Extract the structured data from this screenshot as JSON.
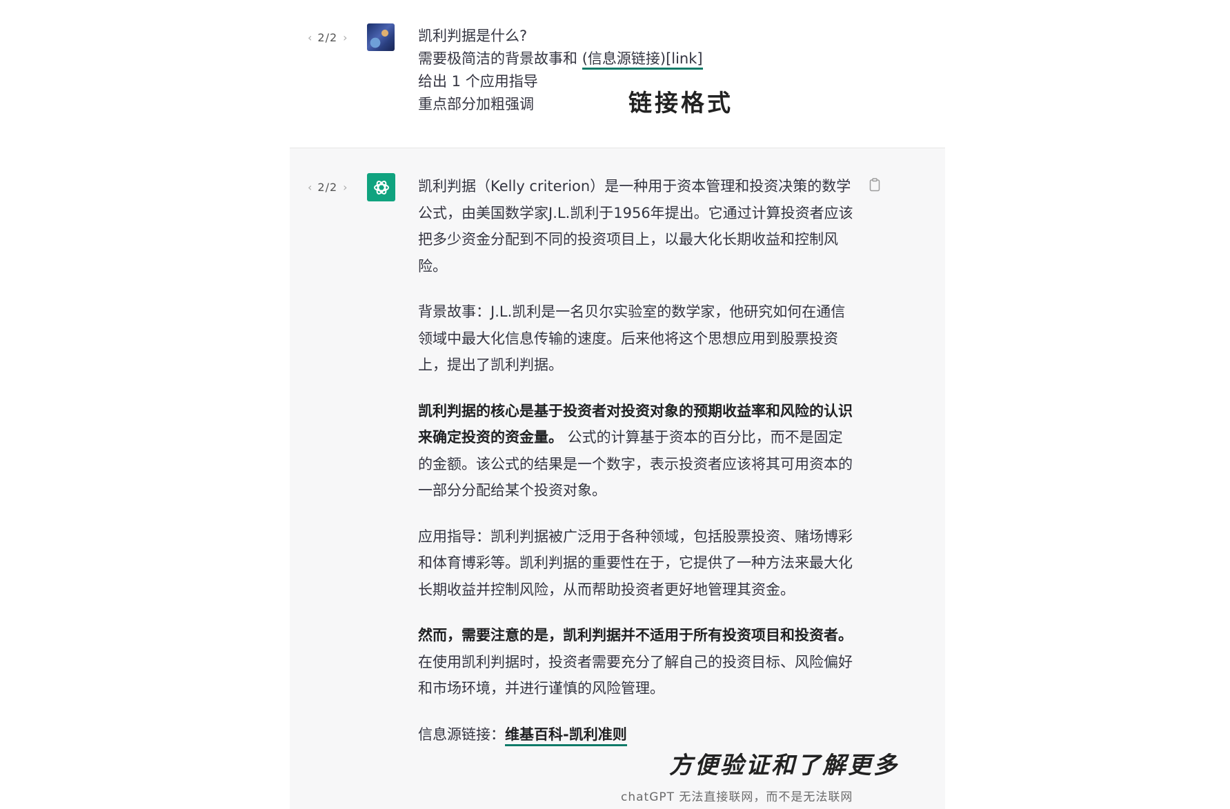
{
  "user_message": {
    "pager": {
      "prev_icon": "‹",
      "count": "2/2",
      "next_icon": "›"
    },
    "avatar_icon": "user-avatar-image",
    "lines": [
      "凯利判据是什么?",
      "需要极简洁的背景故事和 ",
      "(信息源链接)[link]",
      "给出 1 个应用指导",
      "重点部分加粗强调"
    ],
    "annotation": "链接格式"
  },
  "assistant_message": {
    "pager": {
      "prev_icon": "‹",
      "count": "2/2",
      "next_icon": "›"
    },
    "avatar_icon": "openai-logo-icon",
    "copy_icon": "clipboard-icon",
    "paragraphs": {
      "p1": "凯利判据（Kelly criterion）是一种用于资本管理和投资决策的数学公式，由美国数学家J.L.凯利于1956年提出。它通过计算投资者应该把多少资金分配到不同的投资项目上，以最大化长期收益和控制风险。",
      "p2": "背景故事：J.L.凯利是一名贝尔实验室的数学家，他研究如何在通信领域中最大化信息传输的速度。后来他将这个思想应用到股票投资上，提出了凯利判据。",
      "p3_bold": "凯利判据的核心是基于投资者对投资对象的预期收益率和风险的认识来确定投资的资金量。",
      "p3_rest": " 公式的计算基于资本的百分比，而不是固定的金额。该公式的结果是一个数字，表示投资者应该将其可用资本的一部分分配给某个投资对象。",
      "p4": "应用指导：凯利判据被广泛用于各种领域，包括股票投资、赌场博彩和体育博彩等。凯利判据的重要性在于，它提供了一种方法来最大化长期收益并控制风险，从而帮助投资者更好地管理其资金。",
      "p5_bold": "然而，需要注意的是，凯利判据并不适用于所有投资项目和投资者。",
      "p5_rest": " 在使用凯利判据时，投资者需要充分了解自己的投资目标、风险偏好和市场环境，并进行谨慎的风险管理。",
      "source_label": "信息源链接：",
      "source_link": "维基百科-凯利准则"
    },
    "annotation_verify": "方便验证和了解更多",
    "annotation_note": "chatGPT 无法直接联网，而不是无法联网"
  },
  "colors": {
    "gpt_green": "#10a37f",
    "underline_teal": "#0f7a68",
    "assistant_bg": "#f7f7f8"
  }
}
